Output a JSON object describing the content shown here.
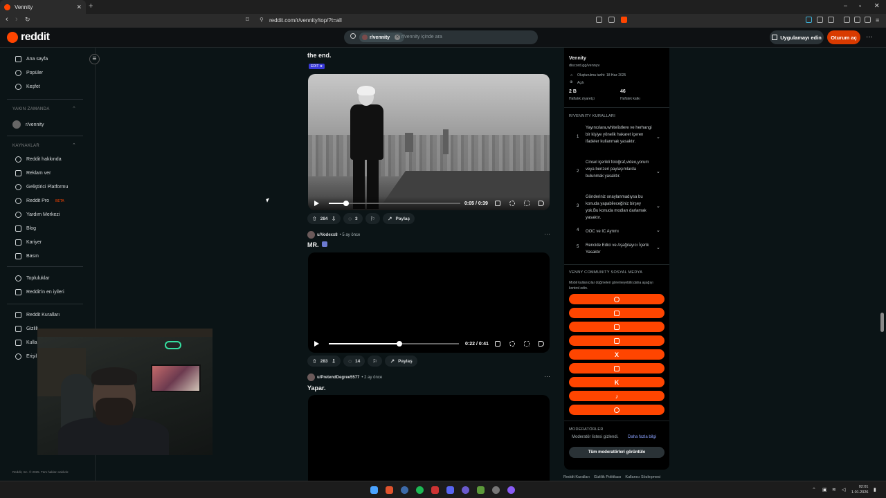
{
  "browser": {
    "tab_title": "Vennity",
    "url": "reddit.com/r/vennity/top/?t=all"
  },
  "header": {
    "logo_text": "reddit",
    "search_chip": "r/vennity",
    "search_placeholder": "r/vennity içinde ara",
    "app_button": "Uygulamayı edin",
    "login_button": "Oturum aç"
  },
  "sidebar": {
    "main_items": [
      {
        "label": "Ana sayfa",
        "icon": "home-icon"
      },
      {
        "label": "Popüler",
        "icon": "popular-icon"
      },
      {
        "label": "Keşfet",
        "icon": "explore-icon"
      }
    ],
    "recent_heading": "YAKIN ZAMANDA",
    "recent_items": [
      {
        "label": "r/vennity"
      }
    ],
    "resources_heading": "KAYNAKLAR",
    "resource_items": [
      {
        "label": "Reddit hakkında"
      },
      {
        "label": "Reklam ver"
      },
      {
        "label": "Geliştirici Platformu"
      },
      {
        "label": "Reddit Pro",
        "badge": "BETA"
      },
      {
        "label": "Yardım Merkezi"
      },
      {
        "label": "Blog"
      },
      {
        "label": "Kariyer"
      },
      {
        "label": "Basın"
      }
    ],
    "community_items": [
      {
        "label": "Topluluklar"
      },
      {
        "label": "Reddit'in en iyileri"
      }
    ],
    "policy_items": [
      {
        "label": "Reddit Kuralları"
      },
      {
        "label": "Gizlili"
      },
      {
        "label": "Kullan"
      },
      {
        "label": "Erişil"
      }
    ],
    "footer": "Reddit, Inc. © 2025. Tüm hakları saklıdır."
  },
  "posts": [
    {
      "title": "the end.",
      "flair": "EDIT ★",
      "time_text": "0:05 / 0:39",
      "progress": 0.13,
      "upvotes": "284",
      "comments": "3",
      "share": "Paylaş"
    },
    {
      "author": "u/Vodexx8",
      "age": "• 5 ay önce",
      "title": "MR.",
      "time_text": "0:22 / 0:41",
      "progress": 0.54,
      "upvotes": "283",
      "comments": "14",
      "share": "Paylaş"
    },
    {
      "author": "u/PretendDegree5577",
      "age": "• 2 ay önce",
      "title": "Yapar."
    }
  ],
  "community": {
    "name": "Vennity",
    "link": "discord.gg/vennyv",
    "created": "Oluşturulma tarihi: 18 Haz 2025",
    "visibility": "Açık",
    "weekly_visitors": "2 B",
    "weekly_visitors_label": "Haftalık ziyaretçi",
    "weekly_contrib": "46",
    "weekly_contrib_label": "Haftalık katkı",
    "rules_heading": "R/VENNITY KURALLARI",
    "rules": [
      {
        "num": "1",
        "text": "Yayıncılara,whitelistlere ve herhangi bir kişiye yönelik hakaret içeren ifadeler kullanmak yasaktır."
      },
      {
        "num": "2",
        "text": "Cinsel içerikli fotoğraf,video,yorum veya benzeri paylaşımlarda bulunmak yasaktır."
      },
      {
        "num": "3",
        "text": "Gönderiniz onaylanmadıysa bu konuda yapabileceğiniz birşey yok.Bu konuda modları darlamak yasaktır."
      },
      {
        "num": "4",
        "text": "OOC ve IC Ayrımı"
      },
      {
        "num": "5",
        "text": "Rencide Edici ve Aşağılayıcı İçerik Yasaktır"
      }
    ],
    "social_heading": "VENNY COMMUNITY SOSYAL MEDYA",
    "social_note": "Mobil kullanıcılar düğmeleri göremeyebilir,daha aşağıyı kontrol edin.",
    "social_icons": [
      "threads-icon",
      "discord-icon",
      "youtube-icon",
      "instagram-icon",
      "x-icon",
      "twitch-icon",
      "kick-icon",
      "tiktok-icon",
      "steam-icon"
    ],
    "mods_heading": "MODERATÖRLER",
    "mods_hidden": "Moderatör listesi gizlendi.",
    "mods_more": "Daha fazla bilgi",
    "mods_button": "Tüm moderatörleri görüntüle"
  },
  "footer_links": [
    "Reddit Kuralları",
    "Gizlilik Politikası",
    "Kullanıcı Sözleşmesi"
  ],
  "taskbar": {
    "time": "02:01",
    "date": "1.01.2026"
  }
}
